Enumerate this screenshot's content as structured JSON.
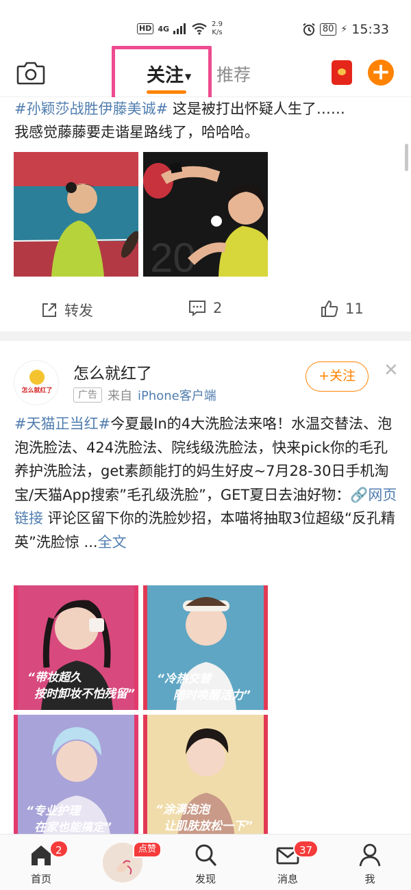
{
  "status_bar": {
    "network_badge": "HD",
    "signal": "4G",
    "speed_value": "2.9",
    "speed_unit": "K/s",
    "battery": "80",
    "time": "15:33"
  },
  "top_nav": {
    "tabs": [
      {
        "label": "关注",
        "active": true
      },
      {
        "label": "推荐",
        "active": false
      }
    ],
    "icons": [
      "camera-icon",
      "red-packet-icon",
      "plus-icon"
    ],
    "accent": "#ff8200",
    "highlight_color": "#ee4b90"
  },
  "post1": {
    "text_line1_topic": "#孙颖莎战胜伊藤美诚#",
    "text_line1_rest": " 这是被打出怀疑人生了……",
    "text_line2": "我感觉藤藤要走谐星路线了，哈哈哈。",
    "images": [
      "table-tennis-player-1",
      "table-tennis-player-2"
    ],
    "actions": {
      "repost_label": "转发",
      "comments_count": "2",
      "likes_count": "11"
    }
  },
  "post2": {
    "author": "怎么就红了",
    "avatar_text": "怎么就红了",
    "ad_tag": "广告",
    "source_prefix": "来自",
    "source_name": "iPhone客户端",
    "follow_label": "+关注",
    "text_topic": "#天猫正当红#",
    "text_body": "今夏最In的4大洗脸法来咯！水温交替法、泡泡洗脸法、424洗脸法、院线级洗脸法，快来pick你的毛孔养护洗脸法，get素颜能打的妈生好皮~7月28-30日手机淘宝/天猫App搜索”毛孔级洗脸”，GET夏日去油好物：",
    "link_label": "网页链接",
    "text_after_link": " 评论区留下你的洗脸妙招，本喵将抽取3位超级“反孔精英”洗脸惊 ...",
    "expand_label": "全文",
    "images": [
      {
        "caption_line1": "“带妆超久",
        "caption_line2": "按时卸妆不怕残留”"
      },
      {
        "caption_line1": "“冷热交替",
        "caption_line2": "随时唤醒活力”"
      },
      {
        "caption_line1": "“专业护理",
        "caption_line2": "在家也能搞定”"
      },
      {
        "caption_line1": "“涂满泡泡",
        "caption_line2": "让肌肤放松一下”"
      }
    ]
  },
  "bottom_nav": {
    "items": [
      {
        "label": "首页",
        "badge": "2"
      },
      {
        "label": "点赞"
      },
      {
        "label": "发现"
      },
      {
        "label": "消息",
        "badge": "37"
      },
      {
        "label": "我"
      }
    ]
  }
}
